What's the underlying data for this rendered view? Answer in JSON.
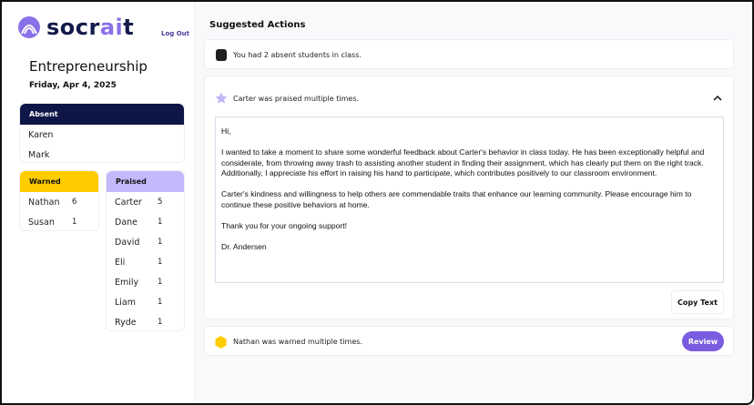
{
  "sidebar": {
    "logo": "socrait",
    "logout": "Log Out",
    "course": "Entrepreneurship",
    "date": "Friday, Apr 4, 2025",
    "absent": {
      "title": "Absent",
      "students": [
        "Karen",
        "Mark"
      ]
    },
    "warned": {
      "title": "Warned",
      "rows": [
        {
          "name": "Nathan",
          "count": "6"
        },
        {
          "name": "Susan",
          "count": "1"
        }
      ]
    },
    "praised": {
      "title": "Praised",
      "rows": [
        {
          "name": "Carter",
          "count": "5"
        },
        {
          "name": "Dane",
          "count": "1"
        },
        {
          "name": "David",
          "count": "1"
        },
        {
          "name": "Eli",
          "count": "1"
        },
        {
          "name": "Emily",
          "count": "1"
        },
        {
          "name": "Liam",
          "count": "1"
        },
        {
          "name": "Ryde",
          "count": "1"
        }
      ]
    }
  },
  "main": {
    "title": "Suggested Actions",
    "actions": [
      {
        "icon": "square-icon",
        "text": "You had 2 absent students in class.",
        "color": "#1e1e1e"
      },
      {
        "icon": "star-icon",
        "text": "Carter was praised multiple times.",
        "color": "#c1b6f7",
        "message": "Hi,\n\nI wanted to take a moment to share some wonderful feedback about Carter's behavior in class today. He has been exceptionally helpful and considerate, from throwing away trash to assisting another student in finding their assignment, which has clearly put them on the right track. Additionally, I appreciate his effort in raising his hand to participate, which contributes positively to our classroom environment.\n\nCarter's kindness and willingness to help others are commendable traits that enhance our learning community. Please encourage him to continue these positive behaviors at home.\n\nThank you for your ongoing support!\n\nDr. Andersen",
        "copy": "Copy Text"
      },
      {
        "icon": "hexagon-icon",
        "text": "Nathan was warned multiple times.",
        "color": "#ffcc00",
        "review": "Review"
      }
    ]
  },
  "colors": {
    "absent": "#0e1547",
    "warned": "#ffcc00",
    "praised": "#c5b8fb",
    "accent": "#7a5ce0"
  }
}
